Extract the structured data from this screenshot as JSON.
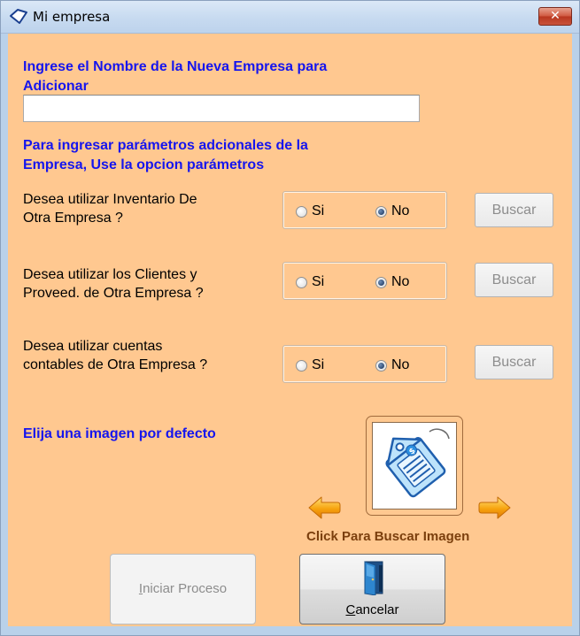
{
  "window": {
    "title": "Mi empresa",
    "close_label": "✕"
  },
  "form": {
    "heading_line1": "Ingrese el Nombre de la Nueva Empresa para",
    "heading_line2": "Adicionar",
    "name_value": "",
    "params_line1": "Para ingresar parámetros adcionales de la",
    "params_line2": "Empresa,  Use la opcion parámetros"
  },
  "questions": [
    {
      "line1": "Desea utilizar Inventario De",
      "line2": "Otra Empresa ?",
      "yes_label": "Si",
      "no_label": "No",
      "selected": "No",
      "button_label": "Buscar"
    },
    {
      "line1": "Desea utilizar los Clientes y",
      "line2": "Proveed. de Otra Empresa ?",
      "yes_label": "Si",
      "no_label": "No",
      "selected": "No",
      "button_label": "Buscar"
    },
    {
      "line1": "Desea utilizar cuentas",
      "line2": "contables de Otra Empresa ?",
      "yes_label": "Si",
      "no_label": "No",
      "selected": "No",
      "button_label": "Buscar"
    }
  ],
  "image_section": {
    "heading": "Elija una imagen por defecto",
    "caption": "Click Para Buscar Imagen",
    "image_icon": "price-tag-icon",
    "prev_icon": "arrow-left-icon",
    "next_icon": "arrow-right-icon"
  },
  "buttons": {
    "start_access_key": "I",
    "start_rest": "niciar Proceso",
    "cancel_access_key": "C",
    "cancel_rest": "ancelar",
    "cancel_icon": "door-exit-icon"
  },
  "colors": {
    "client_background": "#ffc890",
    "heading_text": "#1515ee",
    "caption_text": "#7b3f0d",
    "close_button": "#c9533b"
  }
}
